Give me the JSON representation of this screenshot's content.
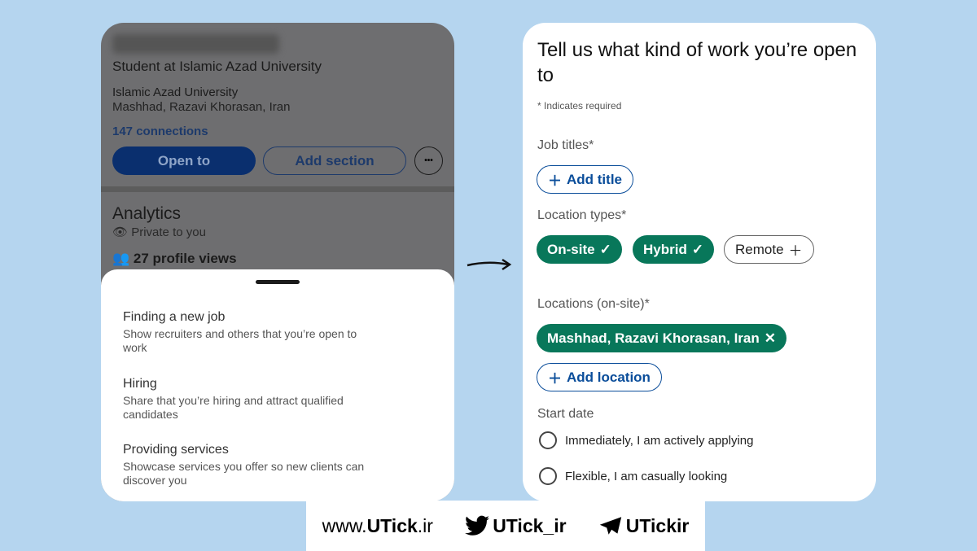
{
  "profile": {
    "headline": "Student at Islamic Azad University",
    "school": "Islamic Azad University",
    "location": "Mashhad, Razavi Khorasan, Iran",
    "connections": "147 connections",
    "open_to": "Open to",
    "add_section": "Add section",
    "more": "•••",
    "analytics_title": "Analytics",
    "analytics_private": "Private to you",
    "profile_views": "27 profile views"
  },
  "sheet": {
    "options": [
      {
        "title": "Finding a new job",
        "desc": "Show recruiters and others that you’re open to work"
      },
      {
        "title": "Hiring",
        "desc": "Share that you’re hiring and attract qualified candidates"
      },
      {
        "title": "Providing services",
        "desc": "Showcase services you offer so new clients can discover you"
      }
    ]
  },
  "form": {
    "title": "Tell us what kind of work you’re open to",
    "required_note": "* Indicates required",
    "job_titles_label": "Job titles*",
    "add_title": "Add title",
    "location_types_label": "Location types*",
    "location_types": [
      {
        "label": "On-site",
        "selected": true
      },
      {
        "label": "Hybrid",
        "selected": true
      },
      {
        "label": "Remote",
        "selected": false
      }
    ],
    "locations_label": "Locations (on-site)*",
    "location_chip": "Mashhad, Razavi Khorasan, Iran",
    "add_location": "Add location",
    "start_date_label": "Start date",
    "start_options": [
      "Immediately, I am actively applying",
      "Flexible, I am casually looking"
    ]
  },
  "footer": {
    "site_prefix": "www.",
    "site_brand": "UTick",
    "site_suffix": ".ir",
    "twitter": "UTick_ir",
    "telegram": "UTickir"
  },
  "colors": {
    "green": "#08775a",
    "blue": "#0a4d9a",
    "background": "#b5d5ef"
  }
}
